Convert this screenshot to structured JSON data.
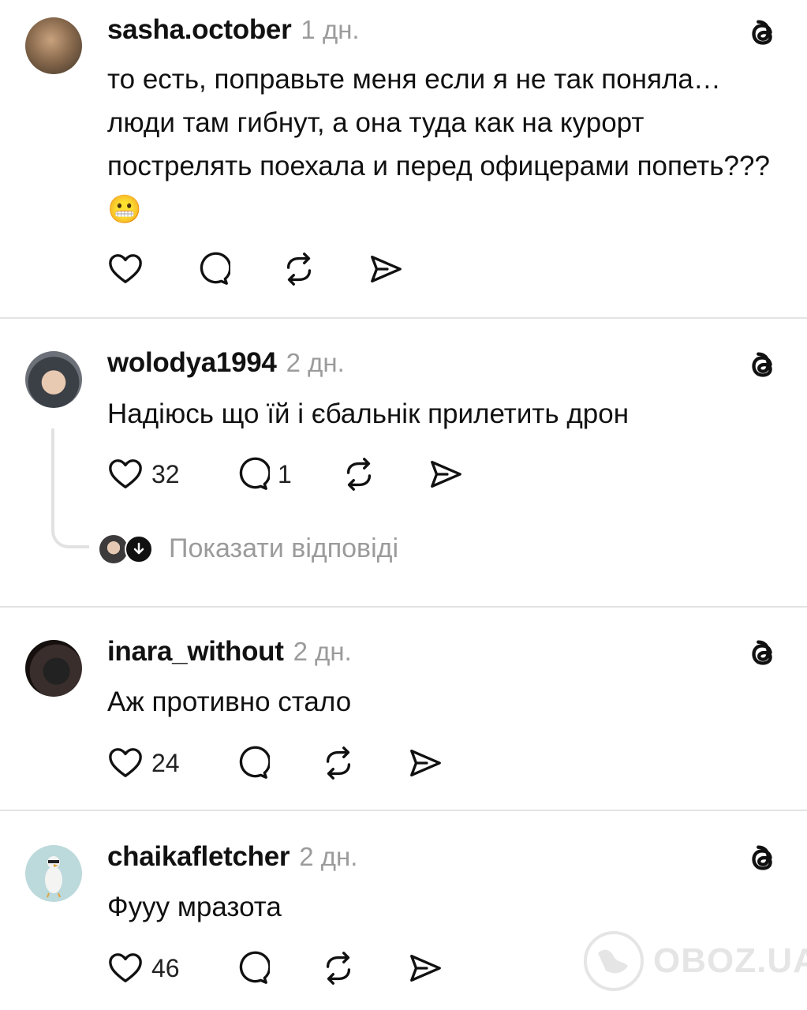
{
  "posts": [
    {
      "username": "sasha.october",
      "time": "1 дн.",
      "text": "то есть, поправьте меня если я не так поняла… люди там гибнут, а она туда как на курорт пострелять поехала и перед офицерами попеть??? 😬",
      "likes": "",
      "replies": ""
    },
    {
      "username": "wolodya1994",
      "time": "2 дн.",
      "text": "Надіюсь що їй і єбальнік прилетить дрон",
      "likes": "32",
      "replies": "1",
      "show_replies_label": "Показати відповіді"
    },
    {
      "username": "inara_without",
      "time": "2 дн.",
      "text": "Аж противно стало",
      "likes": "24",
      "replies": ""
    },
    {
      "username": "chaikafletcher",
      "time": "2 дн.",
      "text": "Фууу мразота",
      "likes": "46",
      "replies": ""
    }
  ],
  "icons": {
    "like": "heart-icon",
    "comment": "comment-icon",
    "repost": "repost-icon",
    "share": "share-icon",
    "platform": "threads-logo-icon"
  },
  "watermark": "OBOZ.UA",
  "colors": {
    "text": "#111111",
    "muted": "#9b9b9b",
    "divider": "#e3e3e3"
  }
}
